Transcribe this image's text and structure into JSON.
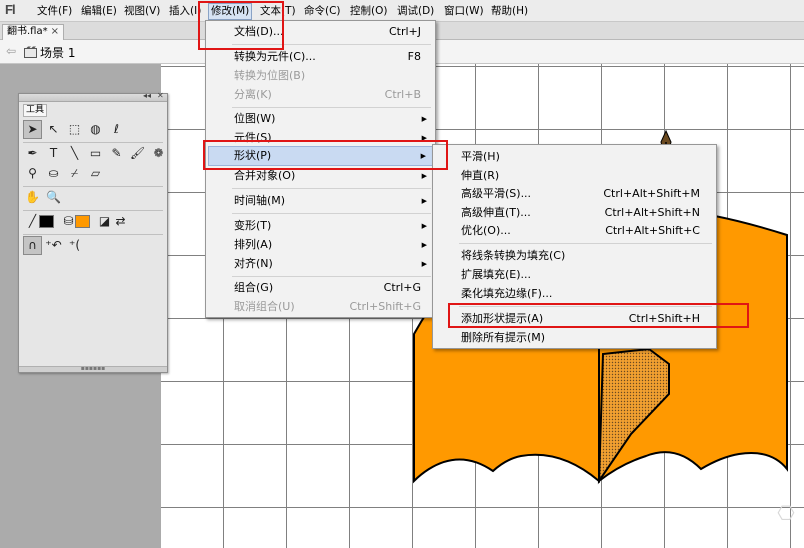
{
  "app": {
    "logo": "Fl"
  },
  "menubar": {
    "items": [
      {
        "label": "文件(F)"
      },
      {
        "label": "编辑(E)"
      },
      {
        "label": "视图(V)"
      },
      {
        "label": "插入(I)"
      },
      {
        "label": "修改(M)"
      },
      {
        "label": "文本(T)"
      },
      {
        "label": "命令(C)"
      },
      {
        "label": "控制(O)"
      },
      {
        "label": "调试(D)"
      },
      {
        "label": "窗口(W)"
      },
      {
        "label": "帮助(H)"
      }
    ]
  },
  "tab": {
    "label": "翻书.fla*",
    "close": "×"
  },
  "scene": {
    "label": "场景 1"
  },
  "tools": {
    "title": "工具",
    "collapse": "◂◂",
    "close": "✕"
  },
  "modify_menu": {
    "items": [
      {
        "label": "文档(D)...",
        "shortcut": "Ctrl+J"
      },
      {
        "label": "转换为元件(C)...",
        "shortcut": "F8"
      },
      {
        "label": "转换为位图(B)",
        "shortcut": ""
      },
      {
        "label": "分离(K)",
        "shortcut": "Ctrl+B"
      },
      {
        "label": "位图(W)"
      },
      {
        "label": "元件(S)"
      },
      {
        "label": "形状(P)"
      },
      {
        "label": "合并对象(O)"
      },
      {
        "label": "时间轴(M)"
      },
      {
        "label": "变形(T)"
      },
      {
        "label": "排列(A)"
      },
      {
        "label": "对齐(N)"
      },
      {
        "label": "组合(G)",
        "shortcut": "Ctrl+G"
      },
      {
        "label": "取消组合(U)",
        "shortcut": "Ctrl+Shift+G"
      }
    ]
  },
  "shape_submenu": {
    "items": [
      {
        "label": "平滑(H)",
        "shortcut": ""
      },
      {
        "label": "伸直(R)",
        "shortcut": ""
      },
      {
        "label": "高级平滑(S)...",
        "shortcut": "Ctrl+Alt+Shift+M"
      },
      {
        "label": "高级伸直(T)...",
        "shortcut": "Ctrl+Alt+Shift+N"
      },
      {
        "label": "优化(O)...",
        "shortcut": "Ctrl+Alt+Shift+C"
      },
      {
        "label": "将线条转换为填充(C)",
        "shortcut": ""
      },
      {
        "label": "扩展填充(E)...",
        "shortcut": ""
      },
      {
        "label": "柔化填充边缘(F)...",
        "shortcut": ""
      },
      {
        "label": "添加形状提示(A)",
        "shortcut": "Ctrl+Shift+H"
      },
      {
        "label": "删除所有提示(M)",
        "shortcut": ""
      }
    ]
  },
  "colors": {
    "fill": "#ff9900",
    "stroke": "#000000",
    "menu_highlight": "#c9daf2",
    "annotation": "#e01515"
  }
}
